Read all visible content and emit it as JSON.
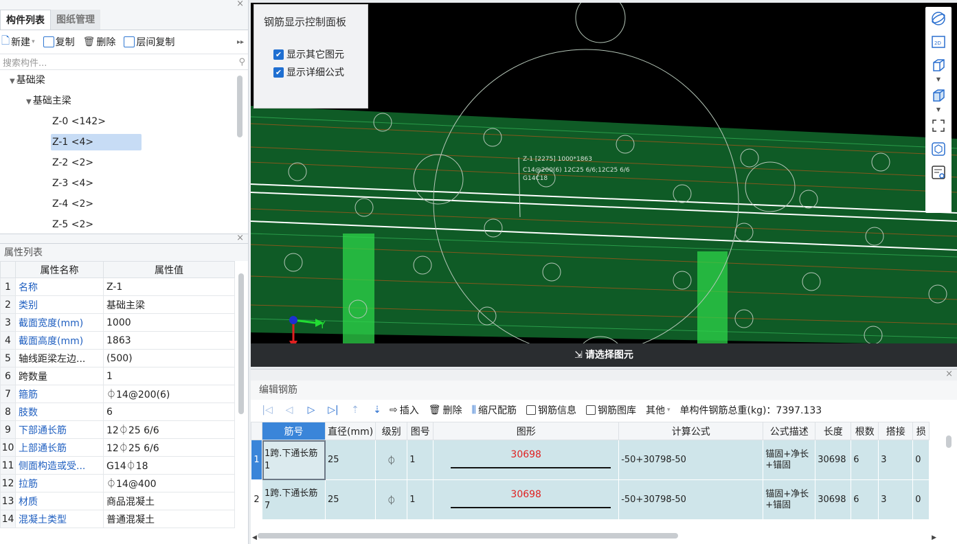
{
  "left_panel": {
    "tabs": [
      "构件列表",
      "图纸管理"
    ],
    "toolbar": {
      "new_label": "新建",
      "copy_label": "复制",
      "delete_label": "删除",
      "floor_copy_label": "层间复制"
    },
    "search_placeholder": "搜索构件...",
    "tree": {
      "root": "基础梁",
      "child": "基础主梁",
      "items": [
        "Z-0 <142>",
        "Z-1 <4>",
        "Z-2 <2>",
        "Z-3 <4>",
        "Z-4 <2>",
        "Z-5 <2>"
      ],
      "selected_index": 1
    }
  },
  "attr_panel": {
    "title": "属性列表",
    "col_name": "属性名称",
    "col_value": "属性值",
    "rows": [
      {
        "no": "1",
        "name": "名称",
        "value": "Z-1",
        "link": true
      },
      {
        "no": "2",
        "name": "类别",
        "value": "基础主梁",
        "link": true
      },
      {
        "no": "3",
        "name": "截面宽度(mm)",
        "value": "1000",
        "link": true
      },
      {
        "no": "4",
        "name": "截面高度(mm)",
        "value": "1863",
        "link": true
      },
      {
        "no": "5",
        "name": "轴线距梁左边...",
        "value": "(500)",
        "link": false
      },
      {
        "no": "6",
        "name": "跨数量",
        "value": "1",
        "link": false
      },
      {
        "no": "7",
        "name": "箍筋",
        "value": "⏀14@200(6)",
        "link": true
      },
      {
        "no": "8",
        "name": "肢数",
        "value": "6",
        "link": true
      },
      {
        "no": "9",
        "name": "下部通长筋",
        "value": "12⏀25 6/6",
        "link": true
      },
      {
        "no": "10",
        "name": "上部通长筋",
        "value": "12⏀25 6/6",
        "link": true
      },
      {
        "no": "11",
        "name": "侧面构造或受...",
        "value": "G14⏀18",
        "link": true
      },
      {
        "no": "12",
        "name": "拉筋",
        "value": "⏀14@400",
        "link": true
      },
      {
        "no": "13",
        "name": "材质",
        "value": "商品混凝土",
        "link": true
      },
      {
        "no": "14",
        "name": "混凝土类型",
        "value": "普通混凝土",
        "link": true
      }
    ]
  },
  "view": {
    "control_panel": {
      "title": "钢筋显示控制面板",
      "show_other": "显示其它图元",
      "show_formula": "显示详细公式"
    },
    "annotation": [
      "Z-1 [2275] 1000*1863",
      "C14@200(6) 12C25 6/6;12C25 6/6",
      "G14C18"
    ],
    "axis_y": "Y",
    "axis_x": "X",
    "hint": "请选择图元",
    "tools": [
      "orbit-icon",
      "2d-icon",
      "cube-icon",
      "cube-fill-icon",
      "fullscreen-icon",
      "box-select-icon",
      "layer-display-icon"
    ]
  },
  "rebar_panel": {
    "title": "编辑钢筋",
    "toolbar": {
      "insert": "插入",
      "delete": "删除",
      "scale": "缩尺配筋",
      "info": "钢筋信息",
      "library": "钢筋图库",
      "other": "其他",
      "total_label": "单构件钢筋总重(kg)：7397.133"
    },
    "columns": [
      "筋号",
      "直径(mm)",
      "级别",
      "图号",
      "图形",
      "计算公式",
      "公式描述",
      "长度",
      "根数",
      "搭接",
      "损"
    ],
    "rows": [
      {
        "no": "1",
        "jinhao": "1跨.下通长筋1",
        "dia": "25",
        "grade": "⏀",
        "fig": "1",
        "shape_value": "30698",
        "formula": "-50+30798-50",
        "desc": "锚固+净长+锚固",
        "len": "30698",
        "count": "6",
        "lap": "3",
        "loss": "0"
      },
      {
        "no": "2",
        "jinhao": "1跨.下通长筋7",
        "dia": "25",
        "grade": "⏀",
        "fig": "1",
        "shape_value": "30698",
        "formula": "-50+30798-50",
        "desc": "锚固+净长+锚固",
        "len": "30698",
        "count": "6",
        "lap": "3",
        "loss": "0"
      }
    ]
  },
  "colors": {
    "accent": "#3a85d9",
    "beam": "#0f5b26",
    "rebar_row": "#cfe5ea",
    "link": "#1f5fc0"
  }
}
